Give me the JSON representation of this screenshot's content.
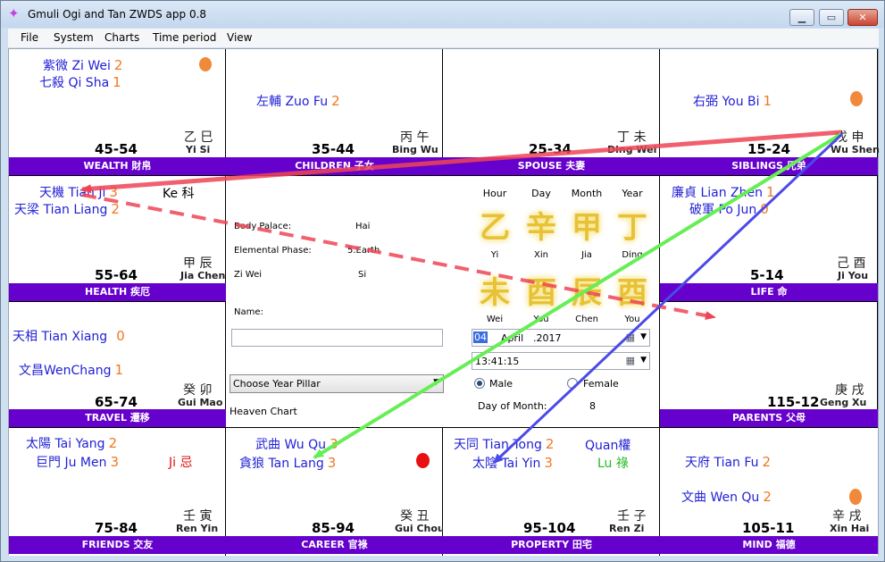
{
  "window": {
    "title": "Gmuli Ogi and Tan ZWDS app 0.8",
    "minimize_glyph": "▁",
    "maximize_glyph": "▭",
    "close_glyph": "✕",
    "app_icon": "sparkle-icon"
  },
  "menu": [
    "File",
    "System",
    "Charts",
    "Time period",
    "View"
  ],
  "palaces": {
    "wealth": {
      "stars": [
        {
          "name": "紫微 Zi Wei",
          "num": "2"
        },
        {
          "name": "七殺 Qi Sha",
          "num": "1"
        }
      ],
      "age": "45-54",
      "stem_cn": "乙  巳",
      "stem_py": "Yi     Si",
      "palace": "WEALTH 財帛",
      "dot_color": "#f08a3a"
    },
    "children": {
      "stars": [
        {
          "name": "左輔 Zuo Fu",
          "num": "2"
        }
      ],
      "age": "35-44",
      "stem_cn": "丙  午",
      "stem_py": "Bing  Wu",
      "palace": "CHILDREN 子女"
    },
    "spouse": {
      "stars": [],
      "age": "25-34",
      "stem_cn": "丁  未",
      "stem_py": "Ding  Wei",
      "palace": "SPOUSE 夫妻"
    },
    "siblings": {
      "stars": [
        {
          "name": "右弼 You Bi",
          "num": "1"
        }
      ],
      "age": "15-24",
      "stem_cn": "戊  申",
      "stem_py": "Wu  Shen",
      "palace": "SIBLINGS 兄弟",
      "dot_color": "#f08a3a"
    },
    "health": {
      "stars": [
        {
          "name": "天機 Tian Ji",
          "num": "3"
        },
        {
          "name": "天梁 Tian Liang",
          "num": "2"
        }
      ],
      "trans": {
        "text": "Ke 科",
        "color": "#f07822"
      },
      "age": "55-64",
      "stem_cn": "甲  辰",
      "stem_py": "Jia  Chen",
      "palace": "HEALTH 疾厄"
    },
    "life": {
      "stars": [
        {
          "name": "廉貞 Lian Zhen",
          "num": "1"
        },
        {
          "name": "破軍 Po Jun",
          "num": "0"
        }
      ],
      "age": "5-14",
      "stem_cn": "己  酉",
      "stem_py": "Ji   You",
      "palace": "LIFE 命"
    },
    "travel": {
      "stars": [
        {
          "name": "天相 Tian Xiang",
          "num": "0"
        },
        {
          "name": "文昌WenChang",
          "num": "1"
        }
      ],
      "age": "65-74",
      "stem_cn": "癸  卯",
      "stem_py": "Gui  Mao",
      "palace": "TRAVEL 遷移"
    },
    "parents": {
      "stars": [],
      "age": "115-12",
      "stem_cn": "庚  戌",
      "stem_py": "Geng  Xu",
      "palace": "PARENTS 父母"
    },
    "friends": {
      "stars": [
        {
          "name": "太陽 Tai Yang",
          "num": "2"
        },
        {
          "name": "巨門 Ju Men",
          "num": "3"
        }
      ],
      "trans": {
        "text": "Ji 忌",
        "color": "#e01010"
      },
      "age": "75-84",
      "stem_cn": "壬  寅",
      "stem_py": "Ren   Yin",
      "palace": "FRIENDS 交友"
    },
    "career": {
      "stars": [
        {
          "name": "武曲 Wu Qu",
          "num": "3"
        },
        {
          "name": "貪狼 Tan Lang",
          "num": "3"
        }
      ],
      "age": "85-94",
      "stem_cn": "癸  丑",
      "stem_py": "Gui Chou",
      "palace": "CAREER 官祿",
      "dot_color": "#e81010"
    },
    "property": {
      "stars": [
        {
          "name": "天同 Tian Tong",
          "num": "2"
        },
        {
          "name": "太陰 Tai Yin",
          "num": "3"
        }
      ],
      "trans": {
        "text": "Quan權",
        "color": "#1f1fd6"
      },
      "trans2": {
        "text": "Lu 祿",
        "color": "#22bb22"
      },
      "age": "95-104",
      "stem_cn": "壬  子",
      "stem_py": "Ren    Zi",
      "palace": "PROPERTY 田宅"
    },
    "mind": {
      "stars": [
        {
          "name": "天府 Tian Fu",
          "num": "2"
        },
        {
          "name": "文曲 Wen Qu",
          "num": "2"
        }
      ],
      "age": "105-11",
      "stem_cn": "辛  戌",
      "stem_py": "Xin   Hai",
      "palace": "MIND 福德",
      "dot_color": "#f08a3a"
    }
  },
  "center": {
    "body_palace_label": "Body Palace:",
    "body_palace_value": "Hai",
    "element_label": "Elemental Phase:",
    "element_value": "5.Earth",
    "ziwei_label": "Zi Wei",
    "ziwei_value": "Si",
    "name_label": "Name:",
    "name_value": "",
    "year_pillar_select": "Choose Year Pillar",
    "heaven_chart_label": "Heaven Chart",
    "pillars": {
      "heads": [
        "Hour",
        "Day",
        "Month",
        "Year"
      ],
      "stems": [
        "乙",
        "辛",
        "甲",
        "丁"
      ],
      "stems_py": [
        "Yi",
        "Xin",
        "Jia",
        "Ding"
      ],
      "branches": [
        "未",
        "酉",
        "辰",
        "酉"
      ],
      "branches_py": [
        "Wei",
        "You",
        "Chen",
        "You"
      ]
    },
    "date_day": "04",
    "date_month": "April",
    "date_year": ".2017",
    "time_value": "13:41:15",
    "male_label": "Male",
    "female_label": "Female",
    "gender_selected": "Male",
    "day_of_month_label": "Day of Month:",
    "day_of_month_value": "8"
  },
  "arrows": [
    {
      "name": "arrow-red-solid",
      "color": "#ee4455"
    },
    {
      "name": "arrow-red-dashed",
      "color": "#ee4455"
    },
    {
      "name": "arrow-green",
      "color": "#66ee55"
    },
    {
      "name": "arrow-blue",
      "color": "#4a4ae8"
    }
  ]
}
